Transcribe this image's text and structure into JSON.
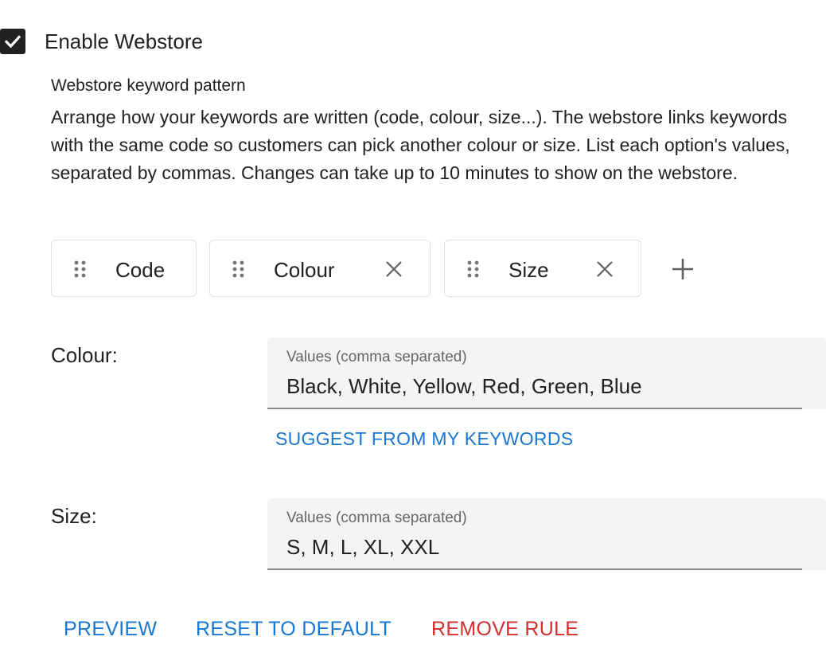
{
  "enable": {
    "label": "Enable Webstore",
    "checked": true
  },
  "description": {
    "title": "Webstore keyword pattern",
    "text": "Arrange how your keywords are written (code, colour, size...). The webstore links keywords with the same code so customers can pick another colour or size. List each option's values, separated by commas. Changes can take up to 10 minutes to show on the webstore."
  },
  "chips": [
    {
      "label": "Code",
      "removable": false
    },
    {
      "label": "Colour",
      "removable": true
    },
    {
      "label": "Size",
      "removable": true
    }
  ],
  "options": {
    "colour": {
      "label": "Colour:",
      "field_label": "Values (comma separated)",
      "value": "Black, White, Yellow, Red, Green, Blue",
      "suggest_label": "SUGGEST FROM MY KEYWORDS"
    },
    "size": {
      "label": "Size:",
      "field_label": "Values (comma separated)",
      "value": "S, M, L, XL, XXL"
    }
  },
  "actions": {
    "preview": "PREVIEW",
    "reset": "RESET TO DEFAULT",
    "remove": "REMOVE RULE"
  },
  "colors": {
    "primary": "#1976d2",
    "danger": "#d32f2f",
    "checkbox": "#212121"
  }
}
